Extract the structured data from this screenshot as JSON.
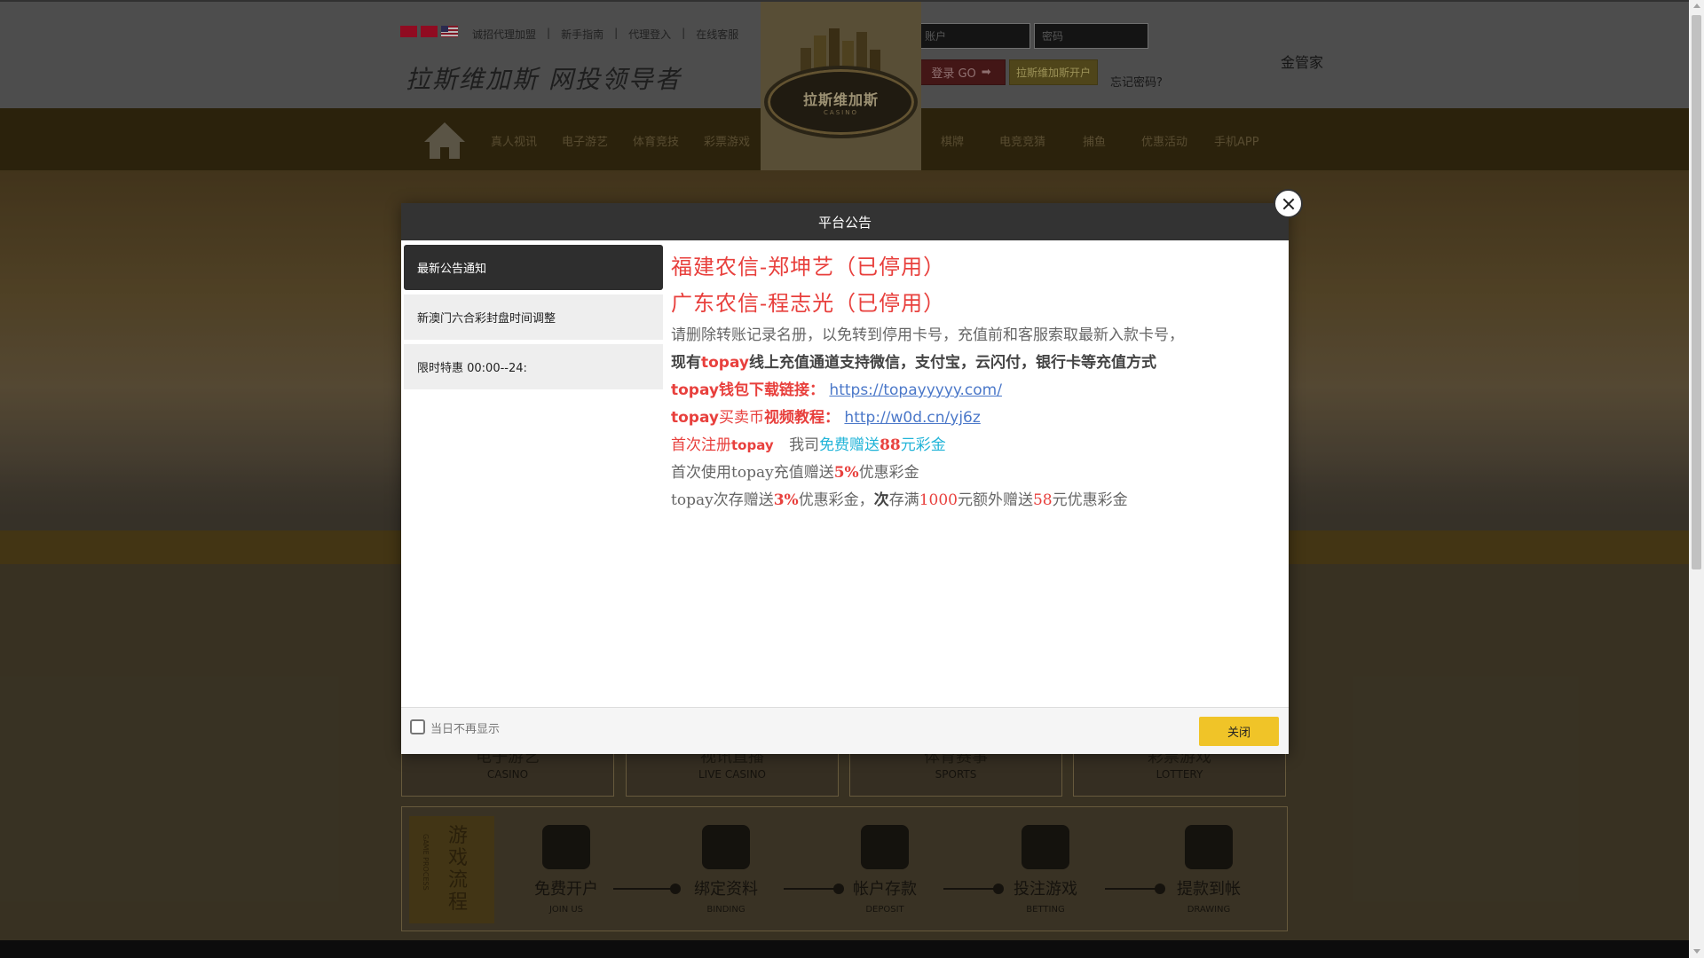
{
  "header": {
    "top_links": [
      "诚招代理加盟",
      "新手指南",
      "代理登入",
      "在线客服"
    ],
    "slogan": "拉斯维加斯 网投领导者",
    "logo_name": "拉斯维加斯",
    "logo_sub": "CASINO",
    "account_placeholder": "账户",
    "password_placeholder": "密码",
    "login_label": "登录 GO",
    "register_label": "拉斯维加斯开户",
    "forgot_label": "忘记密码?",
    "gold_link": "金管家"
  },
  "nav": {
    "left": [
      "真人视讯",
      "电子游艺",
      "体育竞技",
      "彩票游戏"
    ],
    "right": [
      "棋牌",
      "电竞竞猜",
      "捕鱼",
      "优惠活动",
      "手机APP"
    ]
  },
  "categories": [
    {
      "cn": "电子游艺",
      "en": "CASINO"
    },
    {
      "cn": "视讯直播",
      "en": "LIVE CASINO"
    },
    {
      "cn": "体育赛事",
      "en": "SPORTS"
    },
    {
      "cn": "彩票游戏",
      "en": "LOTTERY"
    }
  ],
  "process": {
    "title": "游戏流程",
    "title_en": "GAME PROCESS",
    "steps": [
      {
        "cn": "免费开户",
        "en": "JOIN US"
      },
      {
        "cn": "绑定资料",
        "en": "BINDING"
      },
      {
        "cn": "帐户存款",
        "en": "DEPOSIT"
      },
      {
        "cn": "投注游戏",
        "en": "BETTING"
      },
      {
        "cn": "提款到帐",
        "en": "DRAWING"
      }
    ]
  },
  "modal": {
    "title": "平台公告",
    "tabs": [
      "最新公告通知",
      "新澳门六合彩封盘时间调整",
      "限时特惠 00:00--24:"
    ],
    "notice": {
      "line1": "福建农信-郑坤艺（已停用）",
      "line2": "广东农信-程志光（已停用）",
      "line3": "请删除转账记录名册，以免转到停用卡号，充值前和客服索取最新入款卡号，",
      "line4_a": "现有",
      "line4_b": "topay",
      "line4_c": "线上充值通道支持微信，支付宝，云闪付，银行卡等充值方式",
      "line5_a": "topay钱包下载链接：",
      "line5_link": "https://topayyyyy.com/",
      "line6_a": "topay",
      "line6_b": "买卖币",
      "line6_c": "视频教程：",
      "line6_link": "http://w0d.cn/yj6z",
      "line7_a": "首次注册",
      "line7_b": "topay",
      "line7_c": "我司",
      "line7_d": "免费赠送",
      "line7_e": "88",
      "line7_f": "元彩金",
      "line8_a": "首次使用topay充值赠送",
      "line8_b": "5%",
      "line8_c": "优惠彩金",
      "line9_a": "topay次存赠送",
      "line9_b": "3%",
      "line9_c": "优惠彩金，",
      "line9_d": "次",
      "line9_e": "存满",
      "line9_f": "1000",
      "line9_g": "元额外赠送",
      "line9_h": "58",
      "line9_i": "元优惠彩金"
    },
    "checkbox_label": "当日不再显示",
    "close_label": "关闭"
  },
  "colors": {
    "accent_red": "#e8403d",
    "accent_cyan": "#22b4d8",
    "close_button": "#f0c428",
    "modal_header": "#333333"
  }
}
